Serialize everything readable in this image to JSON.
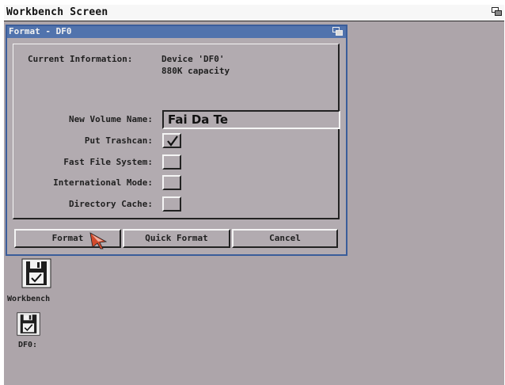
{
  "screen": {
    "title": "Workbench Screen",
    "depth_gadget": "depth-arrange-icon"
  },
  "format_window": {
    "title": "Format - DF0",
    "info_label": "Current Information:",
    "info_device": "Device 'DF0'",
    "info_capacity": "880K capacity",
    "volume_name_label": "New Volume Name:",
    "volume_name_value": "Fai Da Te",
    "options": [
      {
        "label": "Put Trashcan:",
        "checked": true
      },
      {
        "label": "Fast File System:",
        "checked": false
      },
      {
        "label": "International Mode:",
        "checked": false
      },
      {
        "label": "Directory Cache:",
        "checked": false
      }
    ],
    "buttons": {
      "format": "Format",
      "quick_format": "Quick Format",
      "cancel": "Cancel"
    }
  },
  "desktop_icons": [
    {
      "label": "Workbench",
      "icon": "floppy-disk-icon"
    },
    {
      "label": "DF0:",
      "icon": "floppy-disk-icon"
    }
  ],
  "colors": {
    "desktop": "#ada5aa",
    "window_title": "#5173ad",
    "window_bg": "#b2abb0",
    "cursor": "#d24a2c"
  }
}
